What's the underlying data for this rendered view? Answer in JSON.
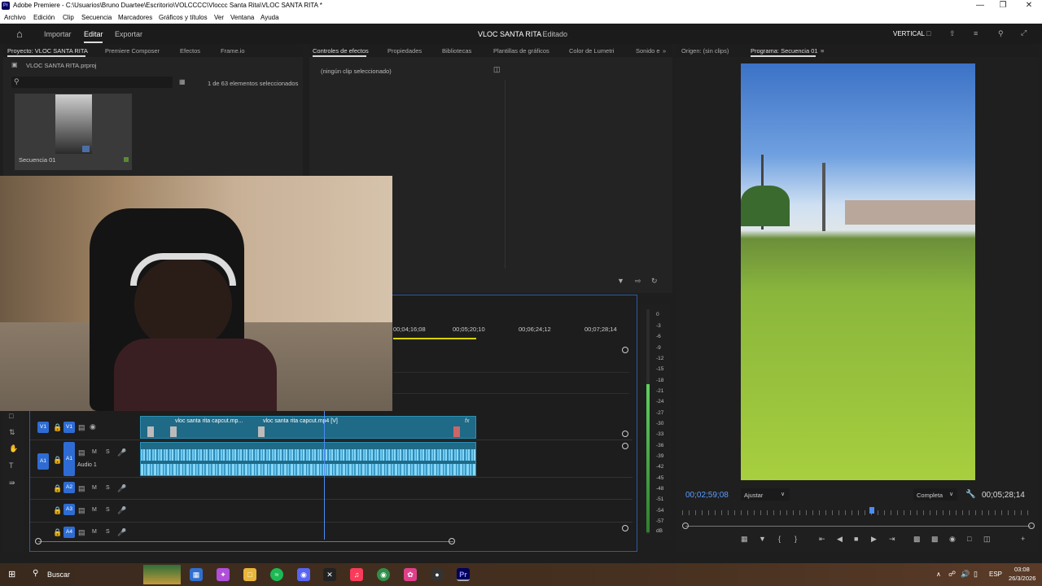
{
  "window": {
    "title": "Adobe Premiere - C:\\Usuarios\\Bruno Duartee\\Escritorio\\VOLCCCC\\Vloccc Santa Rita\\VLOC SANTA RITA *",
    "app_badge": "Pr"
  },
  "menu": [
    "Archivo",
    "Edición",
    "Clip",
    "Secuencia",
    "Marcadores",
    "Gráficos y títulos",
    "Ver",
    "Ventana",
    "Ayuda"
  ],
  "workspace": {
    "import": "Importar",
    "edit": "Editar",
    "export": "Exportar",
    "project_title": "VLOC SANTA RITA",
    "state": "- Editado",
    "layout": "VERTICAL"
  },
  "project_panel": {
    "tabs": [
      "Proyecto: VLOC SANTA RITA",
      "Premiere Composer",
      "Efectos",
      "Frame.io"
    ],
    "file": "VLOC SANTA RITA.prproj",
    "search_placeholder": "",
    "selection_info": "1 de 63 elementos seleccionados",
    "item_label": "Secuencia 01"
  },
  "effects_panel": {
    "tabs": [
      "Controles de efectos",
      "Propiedades",
      "Bibliotecas",
      "Plantillas de gráficos",
      "Color de Lumetri",
      "Sonido e"
    ],
    "no_clip": "(ningún clip seleccionado)"
  },
  "source_monitor": {
    "tab": "Origen: (sin clips)"
  },
  "program_monitor": {
    "tab": "Programa: Secuencia 01",
    "timecode": "00;02;59;08",
    "fit": "Ajustar",
    "quality": "Completa",
    "duration": "00;05;28;14"
  },
  "timeline": {
    "ruler": [
      "00;04;16;08",
      "00;05;20;10",
      "00;06;24;12",
      "00;07;28;14"
    ],
    "tracks": [
      {
        "id": "V1",
        "src": "V1"
      },
      {
        "id": "A1",
        "src": "A1",
        "name": "Audio 1"
      },
      {
        "id": "A2"
      },
      {
        "id": "A3"
      },
      {
        "id": "A4"
      }
    ],
    "clip1": "vloc santa rita capcut.mp...",
    "clip2": "vloc santa rita capcut.mp4 [V]",
    "fx": "fx",
    "mute": "M",
    "solo": "S"
  },
  "audio_meter": {
    "labels": [
      "0",
      "-3",
      "-6",
      "-9",
      "-12",
      "-15",
      "-18",
      "-21",
      "-24",
      "-27",
      "-30",
      "-33",
      "-36",
      "-39",
      "-42",
      "-45",
      "-48",
      "-51",
      "-54",
      "-57",
      "dB"
    ]
  },
  "taskbar": {
    "search": "Buscar",
    "lang": "ESP",
    "time": "03:08",
    "date": "26/3/2026"
  }
}
